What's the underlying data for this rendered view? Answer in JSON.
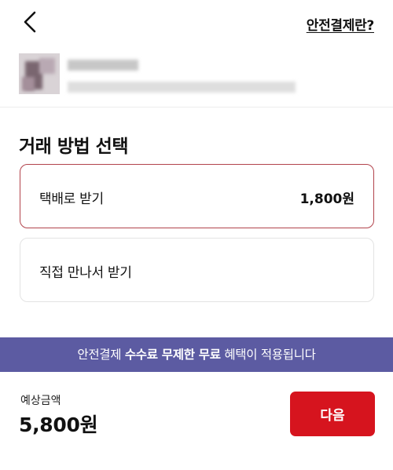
{
  "header": {
    "back_icon": "chevron-left-icon",
    "safe_payment_link": "안전결제란?"
  },
  "section": {
    "title": "거래 방법 선택"
  },
  "options": [
    {
      "label": "택배로 받기",
      "price": "1,800원",
      "selected": true
    },
    {
      "label": "직접 만나서 받기",
      "price": "",
      "selected": false
    }
  ],
  "banner": {
    "prefix": "안전결제 ",
    "highlight": "수수료 무제한 무료",
    "suffix": " 혜택이 적용됩니다",
    "background": "#5c5ba2"
  },
  "footer": {
    "estimate_label": "예상금액",
    "estimate_amount": "5,800원",
    "next_label": "다음",
    "next_color": "#d6141e"
  },
  "colors": {
    "selected_border": "#b2434c"
  }
}
